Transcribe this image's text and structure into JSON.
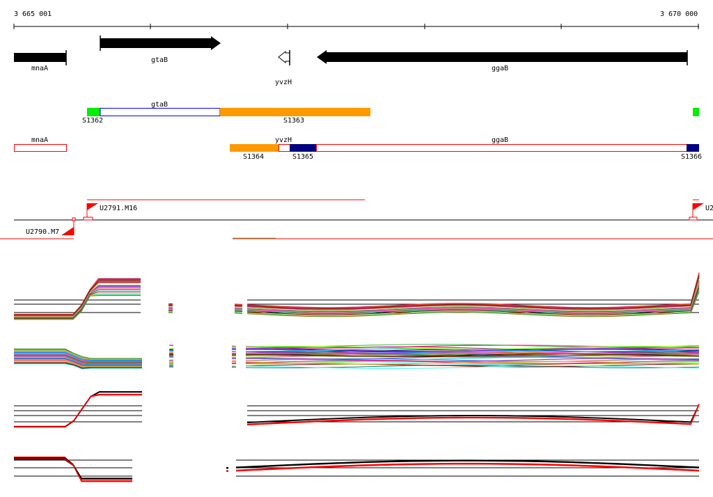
{
  "ruler": {
    "start_label": "3 665 001",
    "end_label": "3 670 000"
  },
  "genes": [
    {
      "name": "mnaA",
      "strand": "+"
    },
    {
      "name": "gtaB",
      "strand": "+"
    },
    {
      "name": "yvzH",
      "strand": "-"
    },
    {
      "name": "ggaB",
      "strand": "-"
    }
  ],
  "segments": {
    "row1_gene_label": "gtaB",
    "row1_labels": [
      "S1362",
      "S1363"
    ],
    "row2_gene_labels": [
      "mnaA",
      "yvzH",
      "ggaB"
    ],
    "row2_labels": [
      "S1364",
      "S1365",
      "S1366"
    ]
  },
  "transcripts": [
    "U2790.M7",
    "U2791.M16",
    "U2"
  ],
  "colors": {
    "gene_arrow": "#000000",
    "segment_green": "#00ee00",
    "segment_orange": "#ff9900",
    "segment_navy": "#000080",
    "gene_outline_blue": "#0000ff",
    "gene_outline_red": "#ff0000",
    "transcript_red": "#ff0000",
    "baseline": "#000000"
  },
  "expression_panels": {
    "count": 4,
    "panel_2_and_4_series": [
      "black",
      "red"
    ]
  }
}
